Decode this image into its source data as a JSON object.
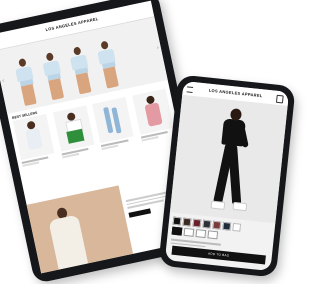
{
  "tablet": {
    "brand": "LOS ANGELES APPAREL",
    "nav": [
      "",
      "",
      "",
      "",
      "",
      "",
      "",
      ""
    ],
    "section_title": "BEST SELLERS",
    "lower_heading": ""
  },
  "phone": {
    "brand": "LOS ANGELES APPAREL",
    "add_button": "ADD TO BAG",
    "swatch_colors": [
      "#111111",
      "#3a2a22",
      "#6b1f2b",
      "#2f2f36",
      "#7a3a3a",
      "#1e2b3b",
      "#ffffff"
    ]
  }
}
